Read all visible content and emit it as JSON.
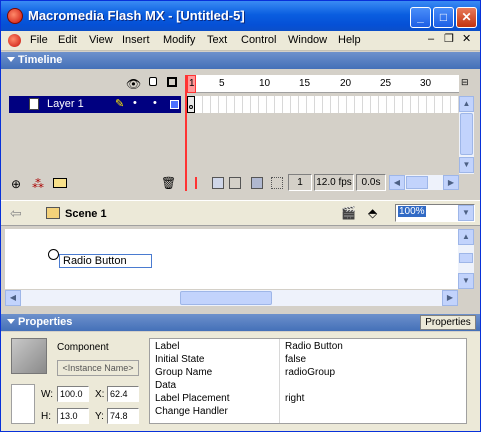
{
  "window": {
    "title": "Macromedia Flash MX - [Untitled-5]"
  },
  "controls": {
    "min": "_",
    "max": "□",
    "close": "✕"
  },
  "menu": [
    "File",
    "Edit",
    "View",
    "Insert",
    "Modify",
    "Text",
    "Control",
    "Window",
    "Help"
  ],
  "timeline": {
    "header": "Timeline",
    "ruler": [
      "1",
      "5",
      "10",
      "15",
      "20",
      "25",
      "30"
    ],
    "layer_name": "Layer 1",
    "frame": "1",
    "fps": "12.0 fps",
    "time": "0.0s"
  },
  "editbar": {
    "scene": "Scene 1",
    "zoom": "100%"
  },
  "stage": {
    "component_label": "Radio Button"
  },
  "properties": {
    "header": "Properties",
    "tab": "Properties",
    "kind": "Component",
    "instance_placeholder": "<Instance Name>",
    "w_label": "W:",
    "w": "100.0",
    "x_label": "X:",
    "x": "62.4",
    "h_label": "H:",
    "h": "13.0",
    "y_label": "Y:",
    "y": "74.8",
    "params": [
      {
        "name": "Label",
        "value": "Radio Button"
      },
      {
        "name": "Initial State",
        "value": "false"
      },
      {
        "name": "Group Name",
        "value": "radioGroup"
      },
      {
        "name": "Data",
        "value": ""
      },
      {
        "name": "Label Placement",
        "value": "right"
      },
      {
        "name": "Change Handler",
        "value": ""
      }
    ]
  },
  "colors": {
    "title_blue": "#0a5ee0",
    "panel_blue": "#4470b8",
    "playhead": "#ff3333",
    "layer_select": "#000080"
  }
}
